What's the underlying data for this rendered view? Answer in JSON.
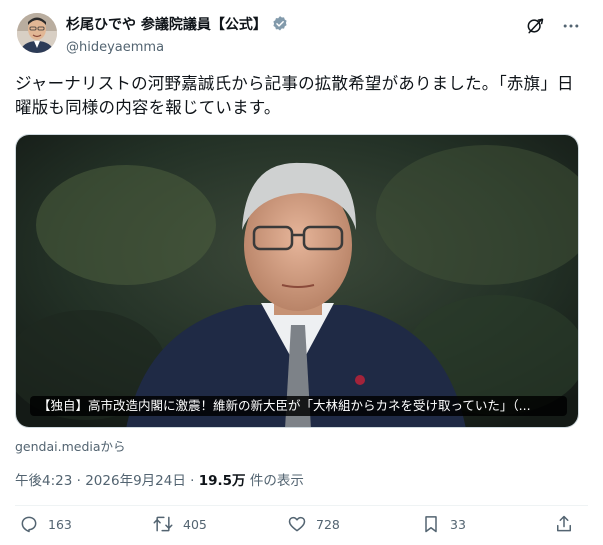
{
  "author": {
    "display_name": "杉尾ひでや 参議院議員【公式】",
    "handle": "@hideyaemma",
    "verified_badge_color": "#829aab"
  },
  "header_icons": [
    "grok-icon",
    "more-icon"
  ],
  "tweet": {
    "text": "ジャーナリストの河野嘉誠氏から記事の拡散希望がありました。「赤旗」日曜版も同様の内容を報じています。"
  },
  "media": {
    "caption": "【独自】高市改造内閣に激震！維新の新大臣が「大林組からカネを受け取っていた」（..."
  },
  "link_source": "gendai.mediaから",
  "meta": {
    "time": "午後4:23",
    "separator": "·",
    "date": "2026年9月24日",
    "views_count": "19.5万",
    "views_label": "件の表示"
  },
  "actions": {
    "replies": "163",
    "reposts": "405",
    "likes": "728",
    "bookmarks": "33"
  },
  "colors": {
    "text": "#0f1419",
    "secondary": "#536471",
    "border": "#cfd9de"
  }
}
